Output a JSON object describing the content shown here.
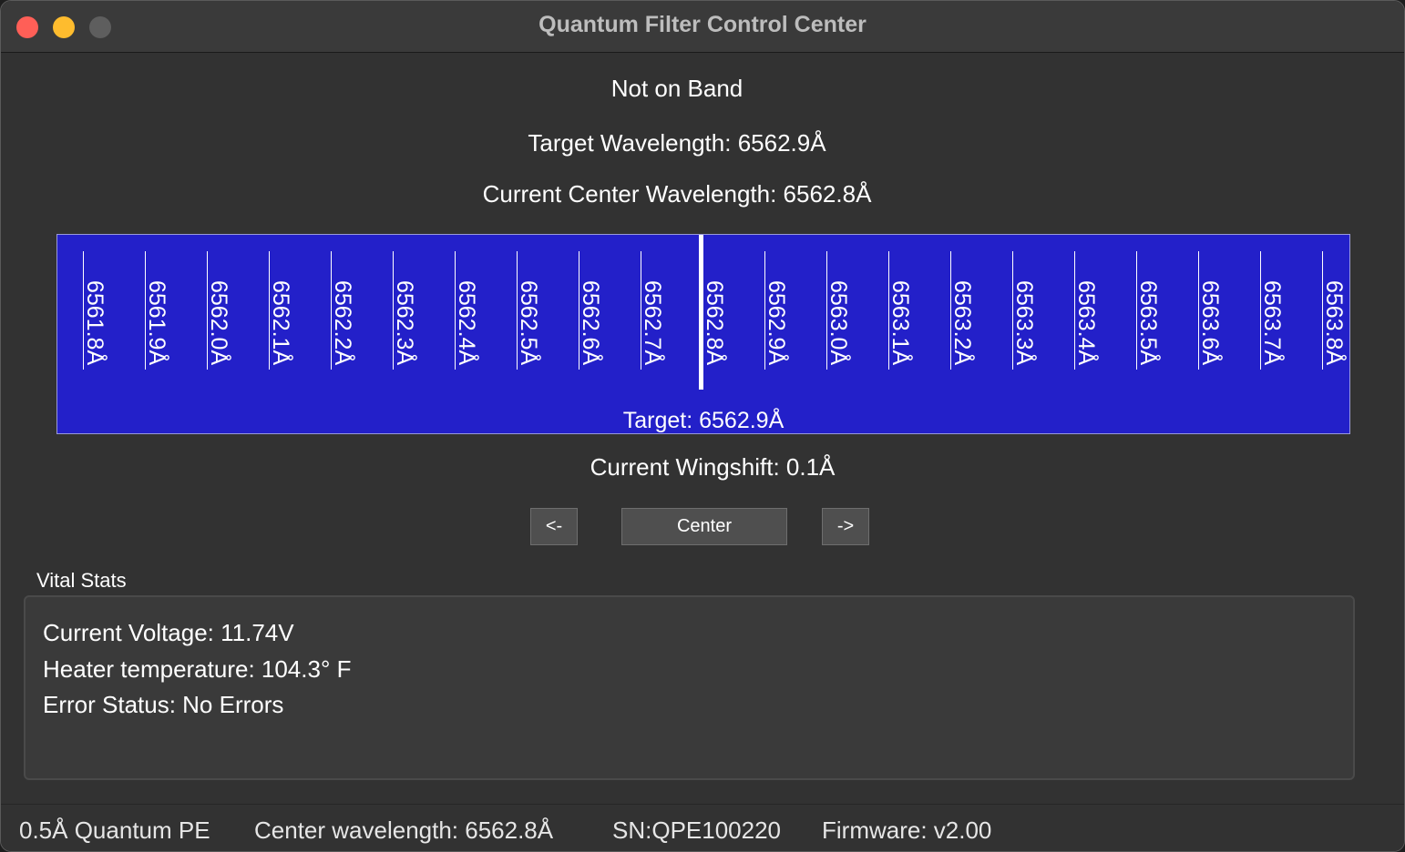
{
  "window": {
    "title": "Quantum Filter Control Center"
  },
  "status_line": "Not on Band",
  "target_wavelength": "Target Wavelength: 6562.9Å",
  "current_center": "Current Center Wavelength: 6562.8Å",
  "band": {
    "ticks": [
      "6561.8Å",
      "6561.9Å",
      "6562.0Å",
      "6562.1Å",
      "6562.2Å",
      "6562.3Å",
      "6562.4Å",
      "6562.5Å",
      "6562.6Å",
      "6562.7Å",
      "6562.8Å",
      "6562.9Å",
      "6563.0Å",
      "6563.1Å",
      "6563.2Å",
      "6563.3Å",
      "6563.4Å",
      "6563.5Å",
      "6563.6Å",
      "6563.7Å",
      "6563.8Å"
    ],
    "target_label": "Target: 6562.9Å",
    "background_color": "#2320c9"
  },
  "wingshift": "Current Wingshift: 0.1Å",
  "controls": {
    "left_label": "<-",
    "center_label": "Center",
    "right_label": "->"
  },
  "vitals": {
    "section_label": "Vital Stats",
    "voltage": "Current Voltage: 11.74V",
    "heater": "Heater temperature: 104.3° F",
    "error_status": "Error Status: No Errors"
  },
  "statusbar": {
    "model": "0.5Å Quantum PE",
    "center_wavelength": "Center wavelength: 6562.8Å",
    "serial": "SN:QPE100220",
    "firmware": "Firmware: v2.00"
  }
}
